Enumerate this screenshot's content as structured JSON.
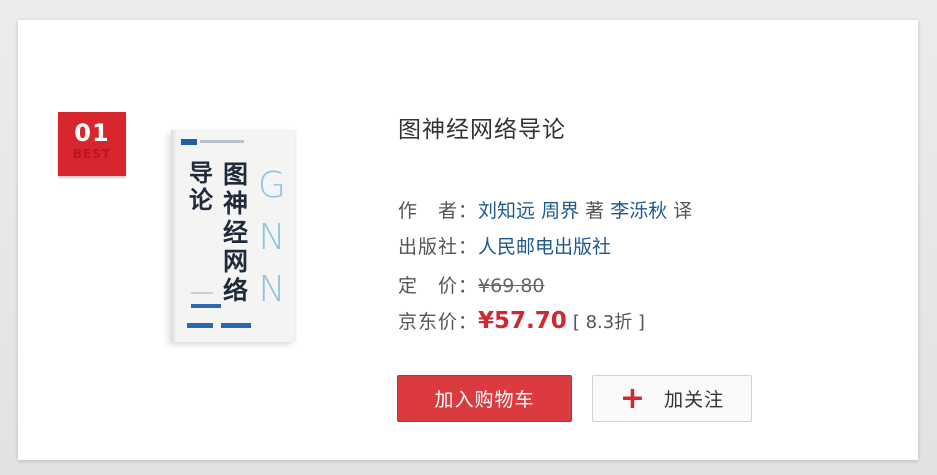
{
  "rank": {
    "number": "01",
    "tag": "BEST"
  },
  "book": {
    "title": "图神经网络导论",
    "cover": {
      "title_part_a": "导论",
      "title_part_b": "图神经网络",
      "logo_letters": "GNN"
    },
    "author_label": "作　者：",
    "authors": [
      "刘知远",
      "周界"
    ],
    "author_role": "著",
    "translator": "李泺秋",
    "translator_role": "译",
    "publisher_label": "出版社：",
    "publisher": "人民邮电出版社",
    "list_price_label": "定　价：",
    "list_price": "¥69.80",
    "jd_price_label": "京东价：",
    "jd_price": "¥57.70",
    "discount": "[ 8.3折 ]"
  },
  "actions": {
    "add_to_cart": "加入购物车",
    "follow": "加关注",
    "follow_icon": "plus-icon"
  },
  "colors": {
    "accent": "#d8262f",
    "link": "#1e5a8f",
    "price": "#cc2a30"
  }
}
